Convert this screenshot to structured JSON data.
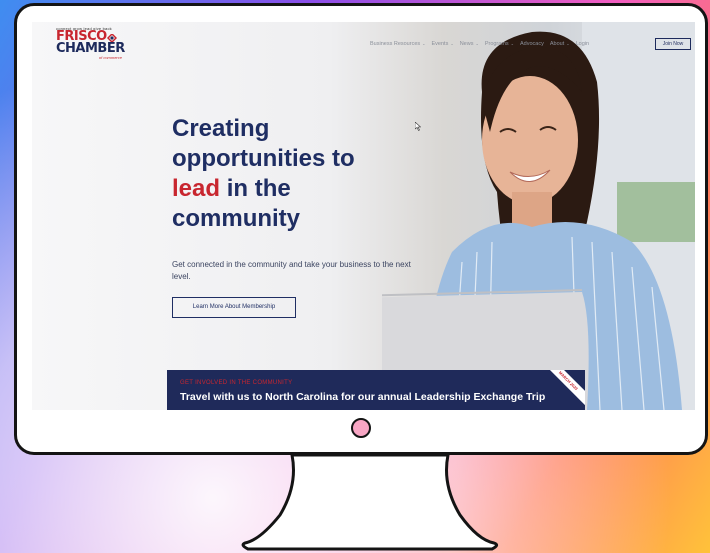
{
  "logo": {
    "tagline": "connect grow lead give back",
    "line1": "FRISCO",
    "line2": "CHAMBER",
    "subline": "of commerce"
  },
  "nav": {
    "items": [
      {
        "label": "Business Resources",
        "dropdown": true
      },
      {
        "label": "Events",
        "dropdown": true
      },
      {
        "label": "News",
        "dropdown": true
      },
      {
        "label": "Programs",
        "dropdown": true
      },
      {
        "label": "Advocacy",
        "dropdown": false
      },
      {
        "label": "About",
        "dropdown": true
      },
      {
        "label": "Login",
        "dropdown": false
      }
    ],
    "join_label": "Join Now"
  },
  "hero": {
    "headline_line1": "Creating",
    "headline_line2": "opportunities to",
    "headline_lead": "lead",
    "headline_line3_rest": " in the",
    "headline_line4": "community",
    "subtext": "Get connected in the community and take your business to the next level.",
    "cta_label": "Learn More About Membership"
  },
  "banner": {
    "kicker": "GET INVOLVED IN THE COMMUNITY",
    "title": "Travel with us to North Carolina for our annual Leadership Exchange Trip",
    "ribbon": "MARCH 2023"
  },
  "colors": {
    "brand_navy": "#1f2e63",
    "brand_red": "#c8262f",
    "banner_bg": "#1f2a5a"
  }
}
